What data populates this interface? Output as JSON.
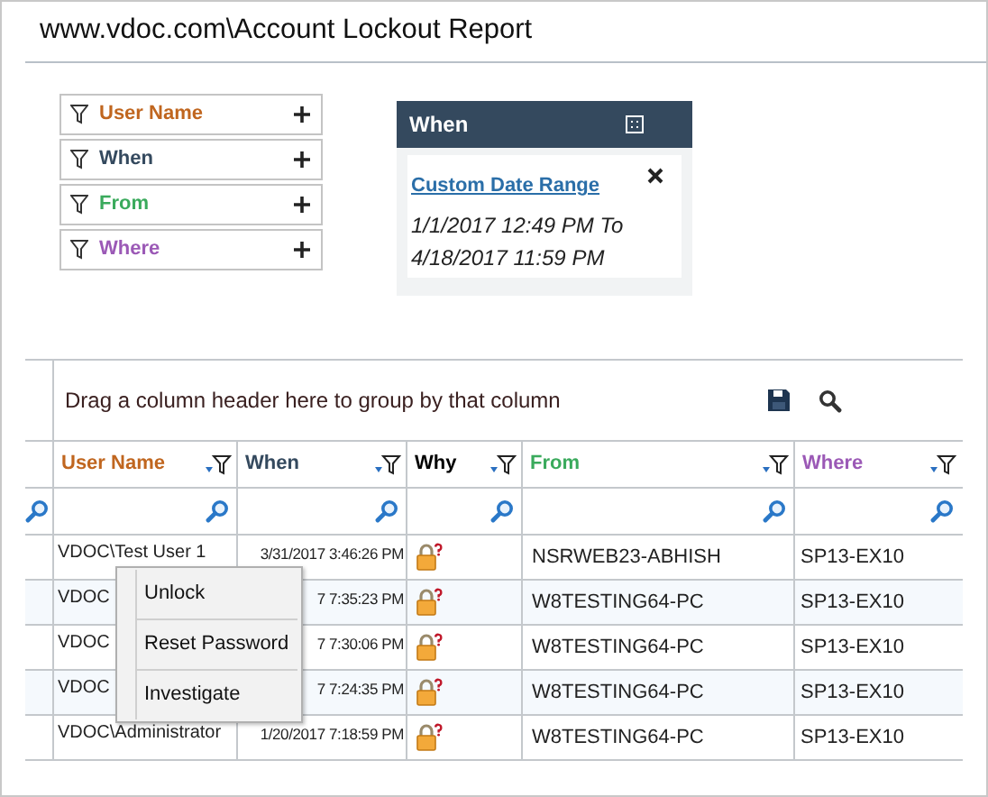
{
  "title": "www.vdoc.com\\Account Lockout Report",
  "filters": [
    {
      "label": "User Name",
      "color": "#c0661f"
    },
    {
      "label": "When",
      "color": "#34495e"
    },
    {
      "label": "From",
      "color": "#3aaa5c"
    },
    {
      "label": "Where",
      "color": "#9b59b6"
    }
  ],
  "when_panel": {
    "title": "When",
    "range_link": "Custom Date Range",
    "range_text": "1/1/2017 12:49 PM To 4/18/2017 11:59 PM"
  },
  "grid": {
    "group_hint": "Drag a column header here to group by that column",
    "columns": [
      {
        "label": "User Name",
        "color": "#c0661f"
      },
      {
        "label": "When",
        "color": "#34495e"
      },
      {
        "label": "Why",
        "color": "#000000"
      },
      {
        "label": "From",
        "color": "#3aaa5c"
      },
      {
        "label": "Where",
        "color": "#9b59b6"
      }
    ],
    "rows": [
      {
        "user": "VDOC\\Test User 1",
        "when": "3/31/2017 3:46:26 PM",
        "from": "NSRWEB23-ABHISH",
        "where": "SP13-EX10"
      },
      {
        "user": "VDOC",
        "when": "7 7:35:23 PM",
        "from": "W8TESTING64-PC",
        "where": "SP13-EX10"
      },
      {
        "user": "VDOC",
        "when": "7 7:30:06 PM",
        "from": "W8TESTING64-PC",
        "where": "SP13-EX10"
      },
      {
        "user": "VDOC",
        "when": "7 7:24:35 PM",
        "from": "W8TESTING64-PC",
        "where": "SP13-EX10"
      },
      {
        "user": "VDOC\\Administrator",
        "when": "1/20/2017 7:18:59 PM",
        "from": "W8TESTING64-PC",
        "where": "SP13-EX10"
      }
    ]
  },
  "context_menu": {
    "items": [
      "Unlock",
      "Reset Password",
      "Investigate"
    ]
  }
}
